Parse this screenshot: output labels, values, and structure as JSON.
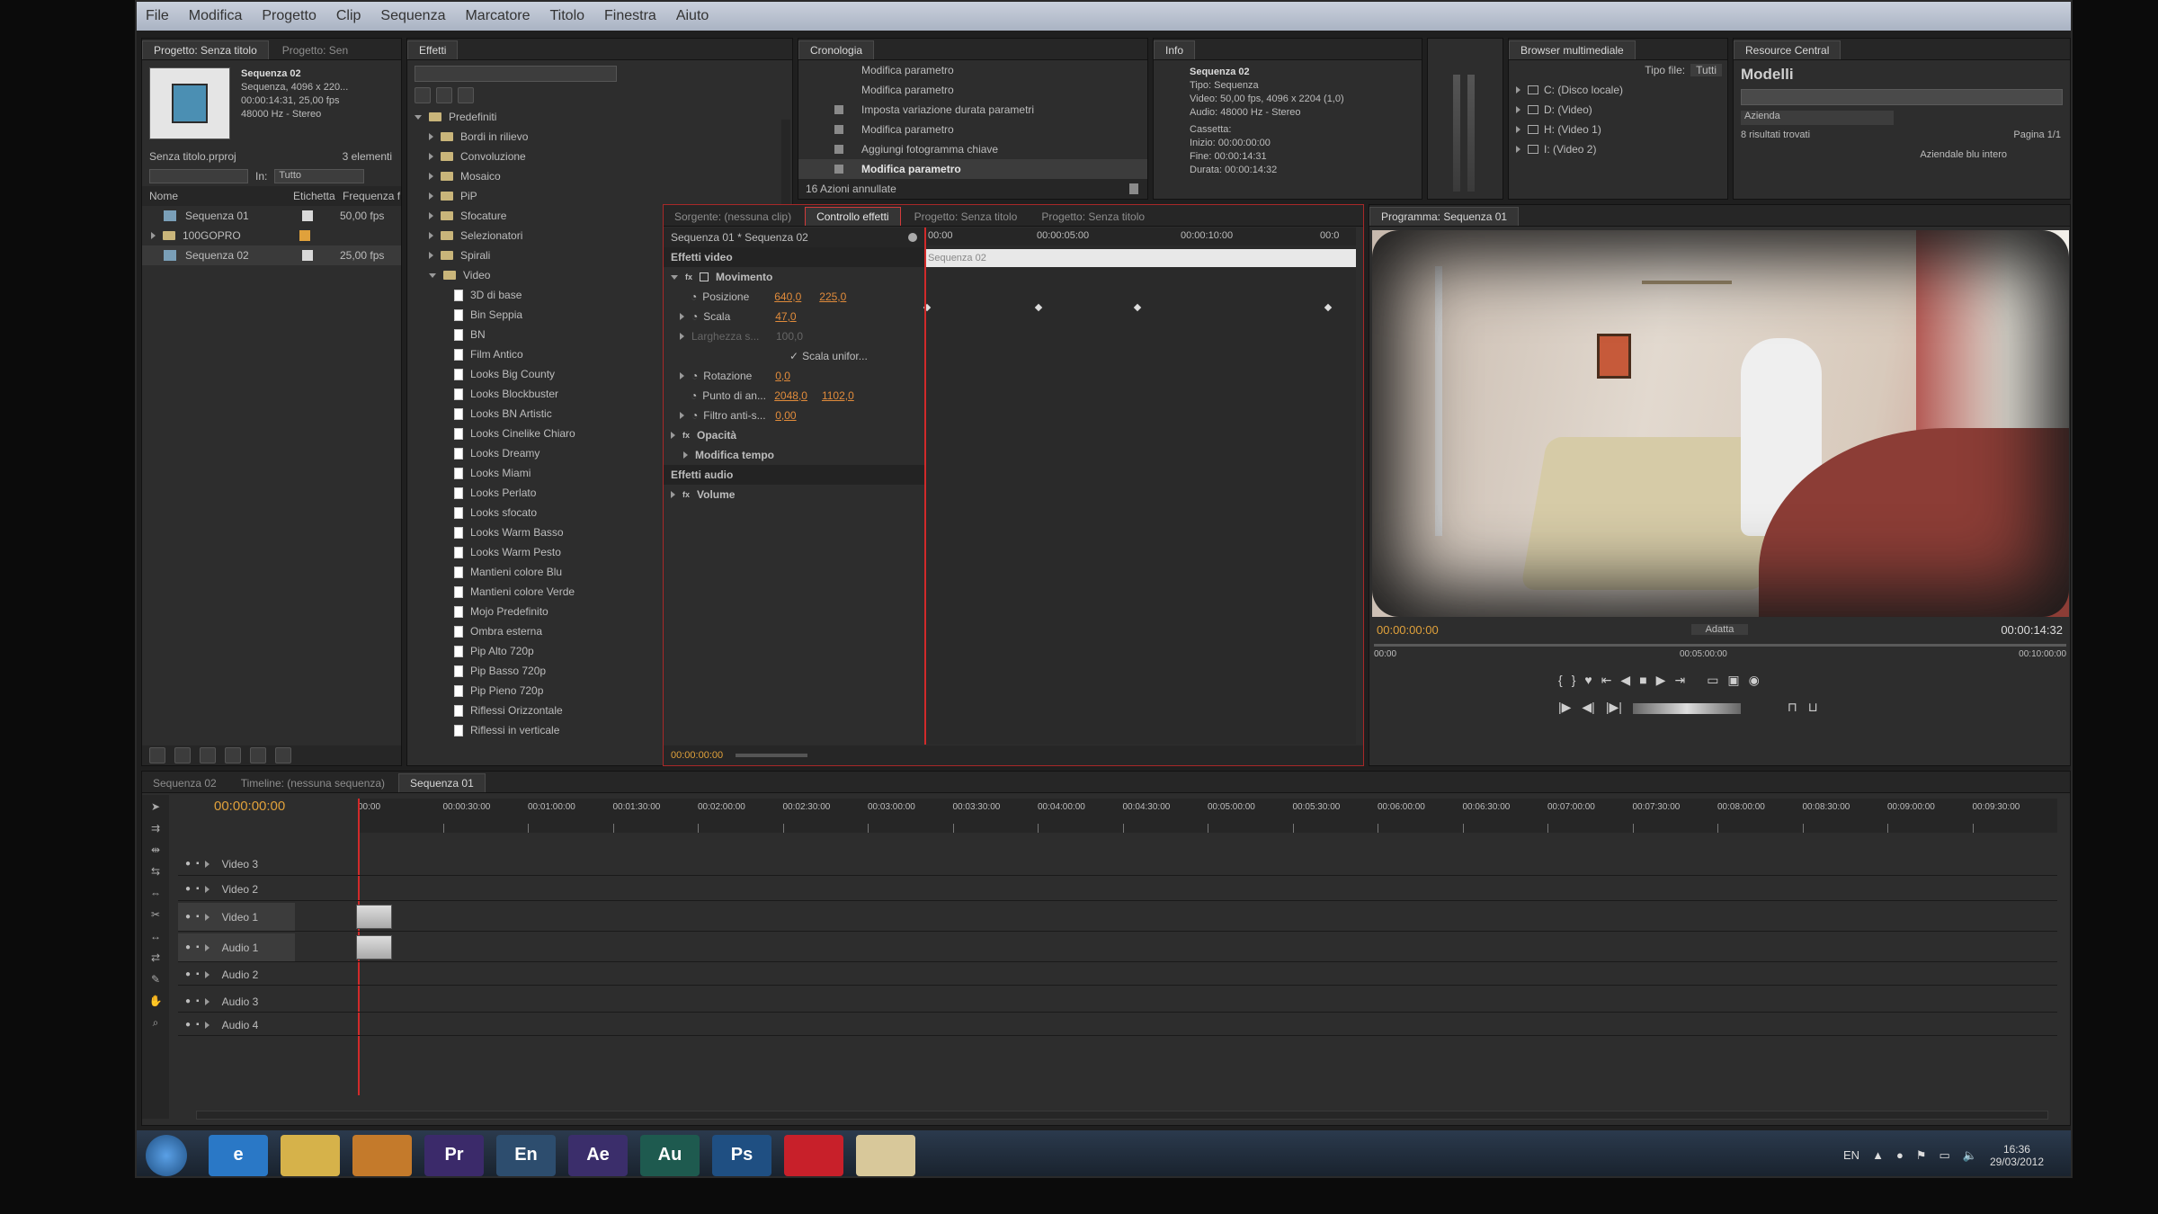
{
  "menu": [
    "File",
    "Modifica",
    "Progetto",
    "Clip",
    "Sequenza",
    "Marcatore",
    "Titolo",
    "Finestra",
    "Aiuto"
  ],
  "project": {
    "tabs": [
      "Progetto: Senza titolo",
      "Progetto: Sen"
    ],
    "clip_name": "Sequenza 02",
    "clip_details": [
      "Sequenza, 4096 x 220...",
      "00:00:14:31, 25,00 fps",
      "48000 Hz - Stereo"
    ],
    "filename": "Senza titolo.prproj",
    "count": "3 elementi",
    "in_label": "In:",
    "in_value": "Tutto",
    "columns": [
      "Nome",
      "Etichetta",
      "Frequenza f"
    ],
    "items": [
      {
        "name": "Sequenza 01",
        "rate": "50,00 fps"
      },
      {
        "name": "100GOPRO",
        "rate": ""
      },
      {
        "name": "Sequenza 02",
        "rate": "25,00 fps"
      }
    ]
  },
  "effects": {
    "tab": "Effetti",
    "folders": [
      "Predefiniti",
      "Bordi in rilievo",
      "Convoluzione",
      "Mosaico",
      "PiP",
      "Sfocature",
      "Selezionatori",
      "Spirali",
      "Video"
    ],
    "presets": [
      "3D di base",
      "Bin Seppia",
      "BN",
      "Film Antico",
      "Looks Big County",
      "Looks Blockbuster",
      "Looks BN Artistic",
      "Looks Cinelike Chiaro",
      "Looks Dreamy",
      "Looks Miami",
      "Looks Perlato",
      "Looks sfocato",
      "Looks Warm Basso",
      "Looks Warm Pesto",
      "Mantieni colore Blu",
      "Mantieni colore Verde",
      "Mojo Predefinito",
      "Ombra esterna",
      "Pip Alto 720p",
      "Pip Basso 720p",
      "Pip Pieno 720p",
      "Riflessi Orizzontale",
      "Riflessi in verticale"
    ]
  },
  "history": {
    "tab": "Cronologia",
    "items": [
      "Modifica parametro",
      "Modifica parametro",
      "Imposta variazione durata parametri",
      "Modifica parametro",
      "Aggiungi fotogramma chiave",
      "Modifica parametro"
    ],
    "footer": "16 Azioni annullate"
  },
  "info": {
    "tab": "Info",
    "title": "Sequenza 02",
    "lines": [
      "Tipo: Sequenza",
      "Video: 50,00 fps, 4096 x 2204 (1,0)",
      "Audio: 48000 Hz - Stereo",
      "Cassetta:",
      "Inizio: 00:00:00:00",
      "Fine: 00:00:14:31",
      "Durata: 00:00:14:32"
    ]
  },
  "media": {
    "tab": "Browser multimediale",
    "filetype_label": "Tipo file:",
    "filetype_value": "Tutti",
    "drives": [
      "C: (Disco locale)",
      "D: (Video)",
      "H: (Video 1)",
      "I: (Video 2)"
    ]
  },
  "resource": {
    "tab": "Resource Central",
    "title": "Modelli",
    "dropdown": "Azienda",
    "results": "8 risultati trovati",
    "page": "Pagina 1/1",
    "download": "Aziendale blu intero"
  },
  "effect_controls": {
    "tabs": [
      "Sorgente: (nessuna clip)",
      "Controllo effetti",
      "Progetto: Senza titolo",
      "Progetto: Senza titolo"
    ],
    "clip": "Sequenza 01 * Sequenza 02",
    "ruler": [
      "00:00",
      "00:00:05:00",
      "00:00:10:00",
      "00:0"
    ],
    "clip_bar": "Sequenza 02",
    "video_effects": "Effetti video",
    "motion": "Movimento",
    "position_label": "Posizione",
    "position_x": "640,0",
    "position_y": "225,0",
    "scale_label": "Scala",
    "scale_value": "47,0",
    "width_label": "Larghezza s...",
    "width_value": "100,0",
    "uniform": "Scala unifor...",
    "rotation_label": "Rotazione",
    "rotation_value": "0,0",
    "anchor_label": "Punto di an...",
    "anchor_x": "2048,0",
    "anchor_y": "1102,0",
    "flicker_label": "Filtro anti-s...",
    "flicker_value": "0,00",
    "opacity": "Opacità",
    "time_remap": "Modifica tempo",
    "audio_effects": "Effetti audio",
    "volume": "Volume",
    "timecode": "00:00:00:00"
  },
  "program": {
    "tab": "Programma: Sequenza 01",
    "timecode_in": "00:00:00:00",
    "fit": "Adatta",
    "timecode_out": "00:00:14:32",
    "ruler_start": "00:00",
    "ruler_mid": "00:05:00:00",
    "ruler_end": "00:10:00:00"
  },
  "timeline": {
    "tabs": [
      "Sequenza 02",
      "Timeline: (nessuna sequenza)",
      "Sequenza 01"
    ],
    "timecode": "00:00:00:00",
    "ruler": [
      "00:00",
      "00:00:30:00",
      "00:01:00:00",
      "00:01:30:00",
      "00:02:00:00",
      "00:02:30:00",
      "00:03:00:00",
      "00:03:30:00",
      "00:04:00:00",
      "00:04:30:00",
      "00:05:00:00",
      "00:05:30:00",
      "00:06:00:00",
      "00:06:30:00",
      "00:07:00:00",
      "00:07:30:00",
      "00:08:00:00",
      "00:08:30:00",
      "00:09:00:00",
      "00:09:30:00"
    ],
    "tracks": [
      "Video 3",
      "Video 2",
      "Video 1",
      "Audio 1",
      "Audio 2",
      "Audio 3",
      "Audio 4"
    ]
  },
  "taskbar": {
    "apps": [
      {
        "icon": "ie-icon",
        "label": "e",
        "color": "#2a78c6"
      },
      {
        "icon": "folder-icon",
        "label": "",
        "color": "#d6b24a"
      },
      {
        "icon": "media-player-icon",
        "label": "",
        "color": "#c47a2b"
      },
      {
        "icon": "premiere-icon",
        "label": "Pr",
        "color": "#3b2a6a"
      },
      {
        "icon": "encore-icon",
        "label": "En",
        "color": "#2d4d6e"
      },
      {
        "icon": "after-effects-icon",
        "label": "Ae",
        "color": "#3b2e6b"
      },
      {
        "icon": "audition-icon",
        "label": "Au",
        "color": "#1e5a4f"
      },
      {
        "icon": "photoshop-icon",
        "label": "Ps",
        "color": "#1f4f82"
      },
      {
        "icon": "acrobat-icon",
        "label": "",
        "color": "#c8202a"
      },
      {
        "icon": "notes-icon",
        "label": "",
        "color": "#d8c89a"
      }
    ],
    "lang": "EN",
    "time": "16:36",
    "date": "29/03/2012"
  }
}
